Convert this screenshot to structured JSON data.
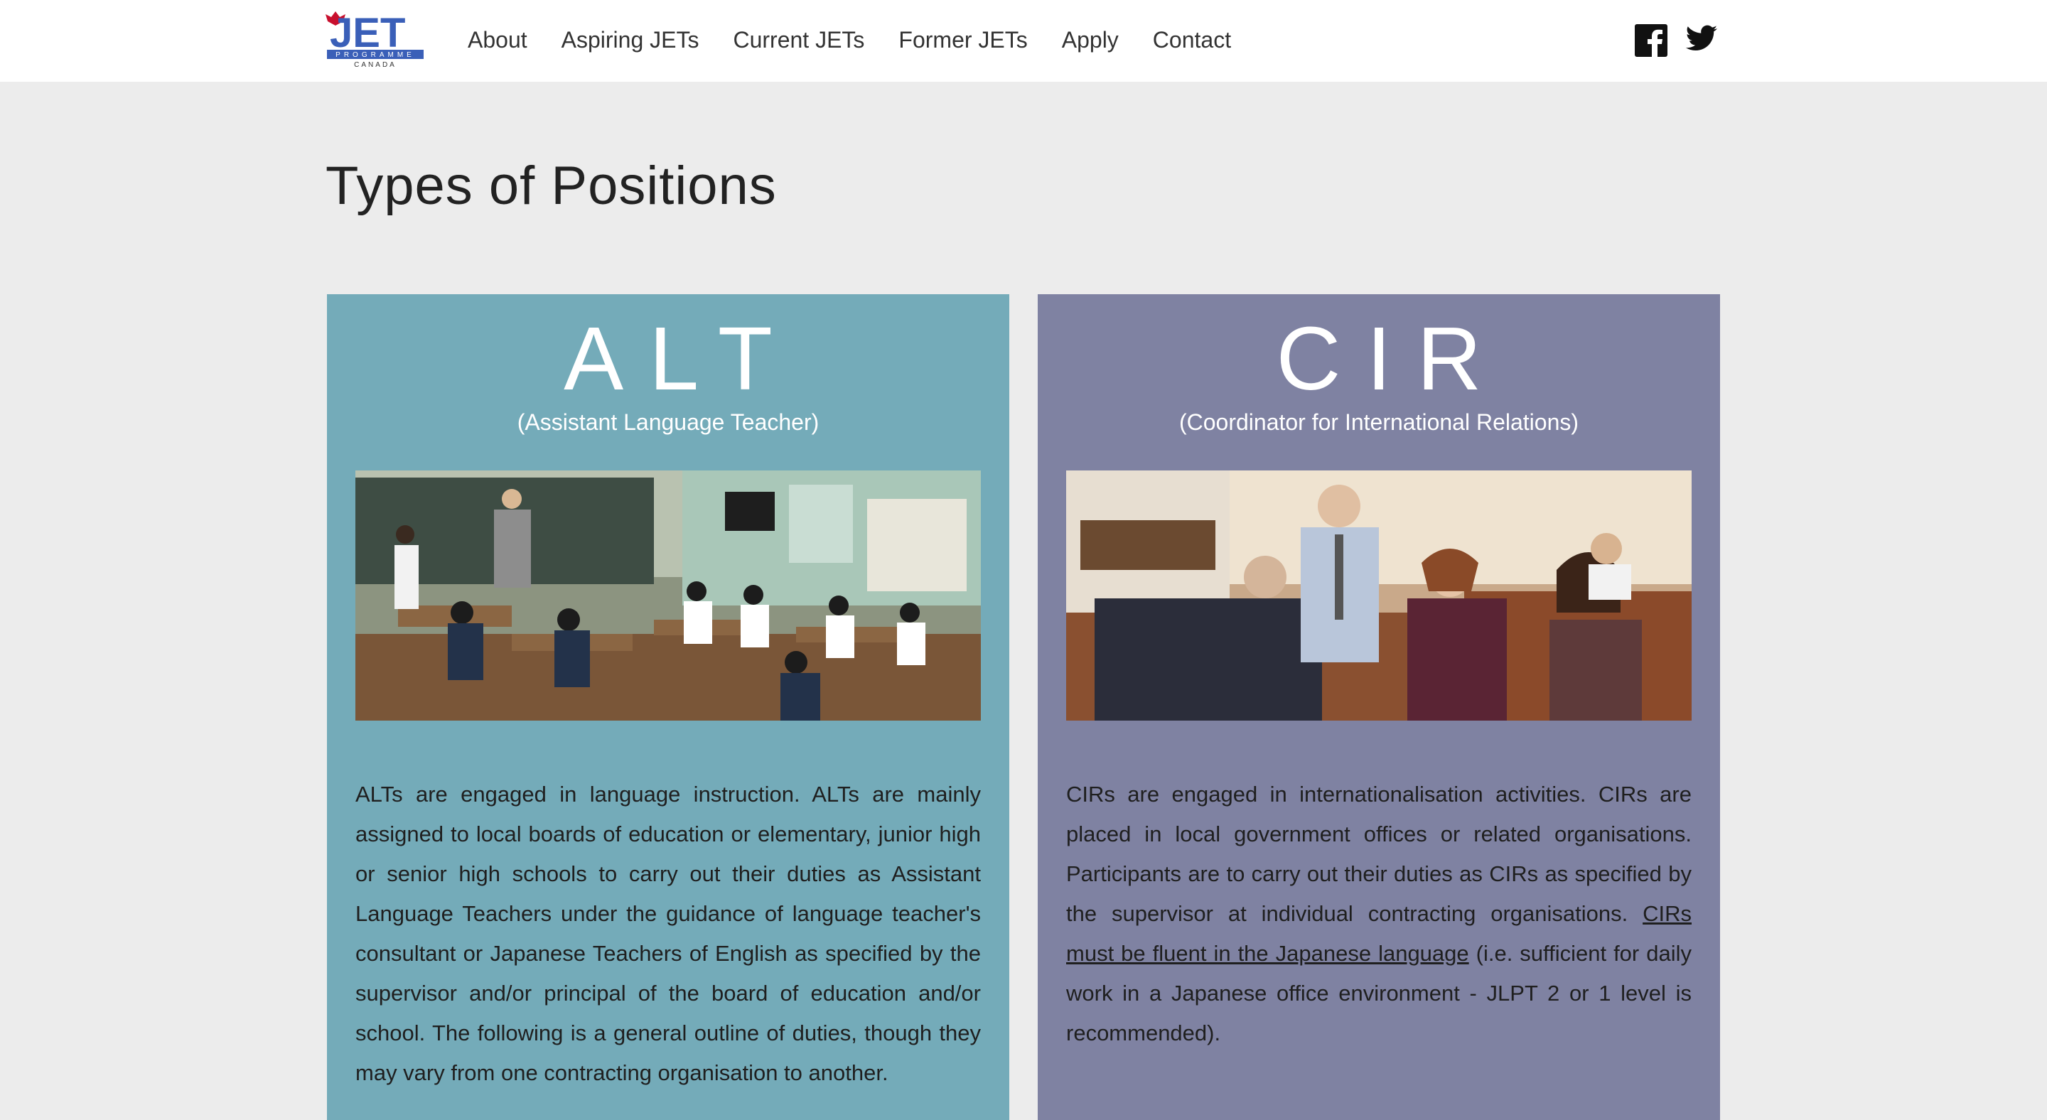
{
  "nav": {
    "logo": {
      "main": "JET",
      "sub": "PROGRAMME",
      "country": "CANADA"
    },
    "links": [
      "About",
      "Aspiring JETs",
      "Current JETs",
      "Former JETs",
      "Apply",
      "Contact"
    ],
    "social": [
      "facebook-icon",
      "twitter-icon"
    ]
  },
  "page": {
    "title": "Types of Positions"
  },
  "cards": [
    {
      "heading": "ALT",
      "subtitle": "(Assistant Language Teacher)",
      "image": "classroom-photo",
      "color": "#74abb9",
      "body": "ALTs are engaged in language instruction. ALTs are mainly assigned to local boards of education or elementary, junior high or senior high schools to carry out their duties as Assistant Language Teachers under the guidance of language teacher's consultant or Japanese Teachers of English as specified by the supervisor and/or principal of the board of education and/or school. The following is a general outline of duties, though they may vary from one contracting organisation to another."
    },
    {
      "heading": "CIR",
      "subtitle": "(Coordinator for International Relations)",
      "image": "office-meeting-photo",
      "color": "#7f82a2",
      "body_before": "CIRs are engaged in internationalisation activities. CIRs are placed in local government offices or related organisations. Participants are to carry out their duties as CIRs as specified by the supervisor at individual contracting organisations. ",
      "body_link": "CIRs must be fluent in the Japanese language",
      "body_after": " (i.e. sufficient for daily work in a Japanese office environment - JLPT 2 or 1 level is recommended)."
    }
  ]
}
